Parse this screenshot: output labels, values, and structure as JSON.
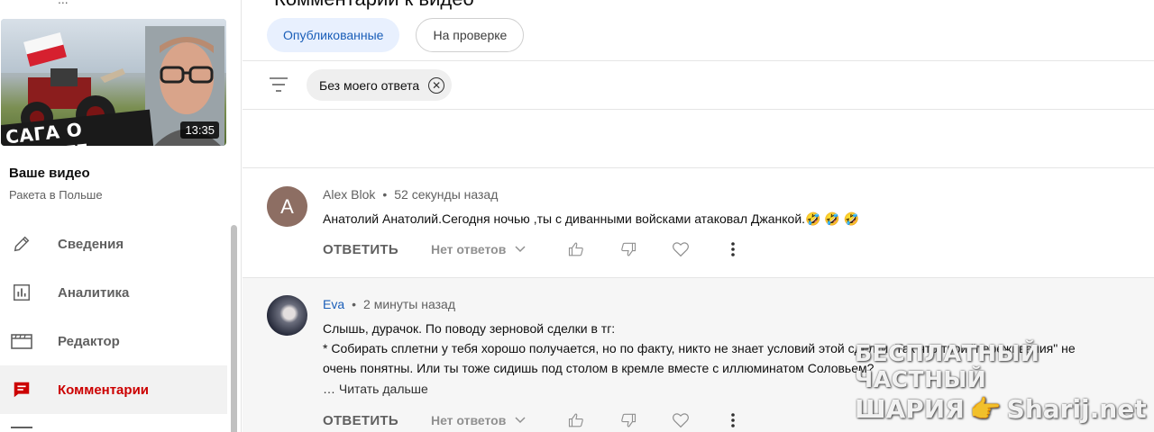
{
  "sidebar": {
    "cut_text": "...",
    "video": {
      "thumbnail_title": "САГА О РАКЕТЕ",
      "duration": "13:35",
      "section_label": "Ваше видео",
      "title": "Ракета в Польше"
    },
    "items": [
      {
        "label": "Сведения",
        "icon": "pencil-icon"
      },
      {
        "label": "Аналитика",
        "icon": "analytics-icon"
      },
      {
        "label": "Редактор",
        "icon": "editor-icon"
      },
      {
        "label": "Комментарии",
        "icon": "comments-icon",
        "active": true
      }
    ]
  },
  "main": {
    "title": "Комментарии к видео",
    "tabs": [
      {
        "label": "Опубликованные",
        "active": true
      },
      {
        "label": "На проверке",
        "active": false
      }
    ],
    "filter_chip": "Без моего ответа"
  },
  "comments": [
    {
      "avatar_letter": "A",
      "author": "Alex Blok",
      "time": "52 секунды назад",
      "lines": [
        "Анатолий Анатолий.Сегодня ночью ,ты с диванными войсками атаковал Джанкой.🤣 🤣 🤣"
      ],
      "reply": "ОТВЕТИТЬ",
      "replies": "Нет ответов"
    },
    {
      "avatar_letter": "",
      "author": "Eva",
      "time": "2 минуты назад",
      "lines": [
        "Слышь, дурачок. По поводу зерновой сделки в тг:",
        "* Собирать сплетни у тебя хорошо получается, но по факту, никто не знает условий этой сделки. Так что твои \"переживания\" не",
        "очень понятны. Или ты тоже сидишь под столом в кремле вместе с иллюминатом Соловьем?"
      ],
      "read_more": "… Читать дальше",
      "reply": "ОТВЕТИТЬ",
      "replies": "Нет ответов"
    }
  ],
  "watermark": {
    "line1": "БЕСПЛАТНЫЙ ЧАСТНЫЙ",
    "line2_a": "ШАРИЯ",
    "line2_b": "Sharij.net"
  },
  "colors": {
    "accent_red": "#cc0000",
    "link_blue": "#1a5eb8",
    "active_tab_bg": "#e8f0fe"
  }
}
